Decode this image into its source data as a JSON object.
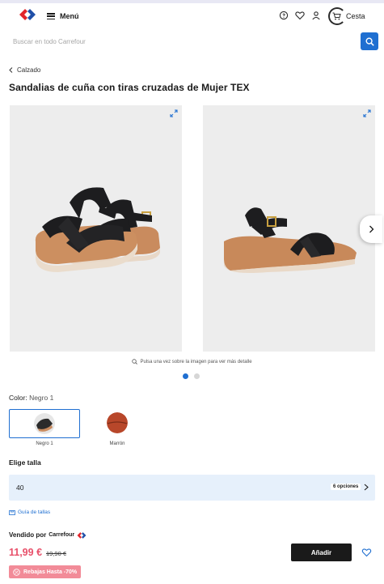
{
  "header": {
    "logo_icon": "carrefour-logo-icon",
    "menu_label": "Menú",
    "cart_label": "Cesta",
    "brand_colors": {
      "blue": "#1f6fd1",
      "red": "#e2242b"
    }
  },
  "search": {
    "placeholder": "Buscar en todo Carrefour"
  },
  "breadcrumb": {
    "label": "Calzado"
  },
  "product": {
    "title": "Sandalias de cuña con tiras cruzadas de Mujer TEX",
    "gallery_hint": "Pulsa una vez sobre la imagen para ver más detalle",
    "images_total": 2,
    "image_active": 1
  },
  "color": {
    "label": "Color:",
    "selected": "Negro 1",
    "options": [
      {
        "name": "Negro 1",
        "swatch": "#2b2b2b"
      },
      {
        "name": "Marrón",
        "swatch": "#b8472a"
      }
    ]
  },
  "size": {
    "label": "Elige talla",
    "value": "40",
    "options_count": "6 opciones",
    "guide_label": "Guía de tallas"
  },
  "purchase": {
    "sold_by": "Vendido por",
    "seller": "Carrefour",
    "price": "11,99 €",
    "old_price": "19,90 €",
    "add_label": "Añadir",
    "promo": "Rebajas Hasta -70%",
    "price_color": "#e8506a"
  }
}
